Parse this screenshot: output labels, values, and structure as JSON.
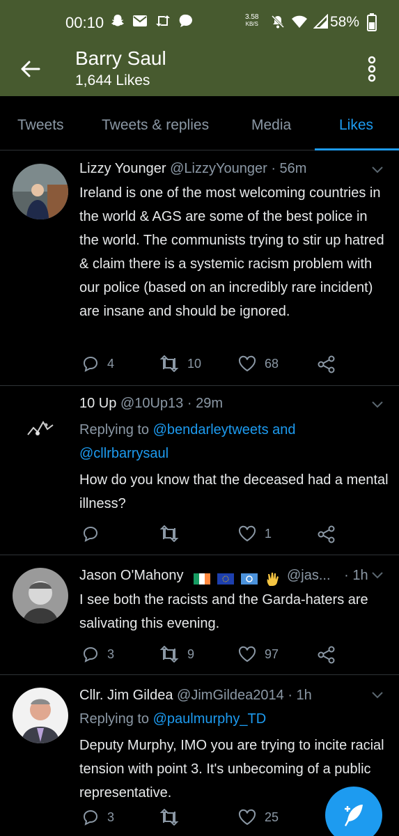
{
  "status_bar": {
    "time": "00:10",
    "net_rate_value": "3.58",
    "net_rate_unit": "KB/S",
    "battery": "58%"
  },
  "header": {
    "title": "Barry Saul",
    "subtitle": "1,644 Likes"
  },
  "tabs": [
    {
      "label": "Tweets"
    },
    {
      "label": "Tweets & replies"
    },
    {
      "label": "Media"
    },
    {
      "label": "Likes"
    }
  ],
  "accent_color": "#1d9bf0",
  "header_color": "#475a2f",
  "tweets": [
    {
      "display_name": "Lizzy Younger",
      "handle": "@LizzyYounger",
      "time": "· 56m",
      "replying_prefix": "",
      "replying_link1": "",
      "replying_mid": "",
      "replying_link2": "",
      "text": "Ireland is one of the most welcoming countries in the world & AGS are some of the best police in the world. The communists trying to stir up hatred & claim there is a systemic racism problem with our police (based on an incredibly rare incident) are insane and should be ignored.",
      "replies": "4",
      "retweets": "10",
      "likes": "68"
    },
    {
      "display_name": "10 Up",
      "handle": "@10Up13",
      "time": "· 29m",
      "replying_prefix": "Replying to ",
      "replying_link1": "@bendarleytweets",
      "replying_mid": " and",
      "replying_link2": "@cllrbarrysaul",
      "text": "How do you know that the deceased had a mental illness?",
      "replies": "",
      "retweets": "",
      "likes": "1"
    },
    {
      "display_name": "Jason O'Mahony",
      "handle": "@jas...",
      "time": "· 1h",
      "replying_prefix": "",
      "replying_link1": "",
      "replying_mid": "",
      "replying_link2": "",
      "text": "I see both the racists and the Garda-haters are salivating this evening.",
      "replies": "3",
      "retweets": "9",
      "likes": "97"
    },
    {
      "display_name": "Cllr. Jim Gildea",
      "handle": "@JimGildea2014",
      "time": "· 1h",
      "replying_prefix": "Replying to ",
      "replying_link1": "@paulmurphy_TD",
      "replying_mid": "",
      "replying_link2": "",
      "text": "Deputy Murphy, IMO you are trying to incite racial tension with point 3. It's unbecoming of a public representative.",
      "replies": "3",
      "retweets": "",
      "likes": "25"
    }
  ]
}
